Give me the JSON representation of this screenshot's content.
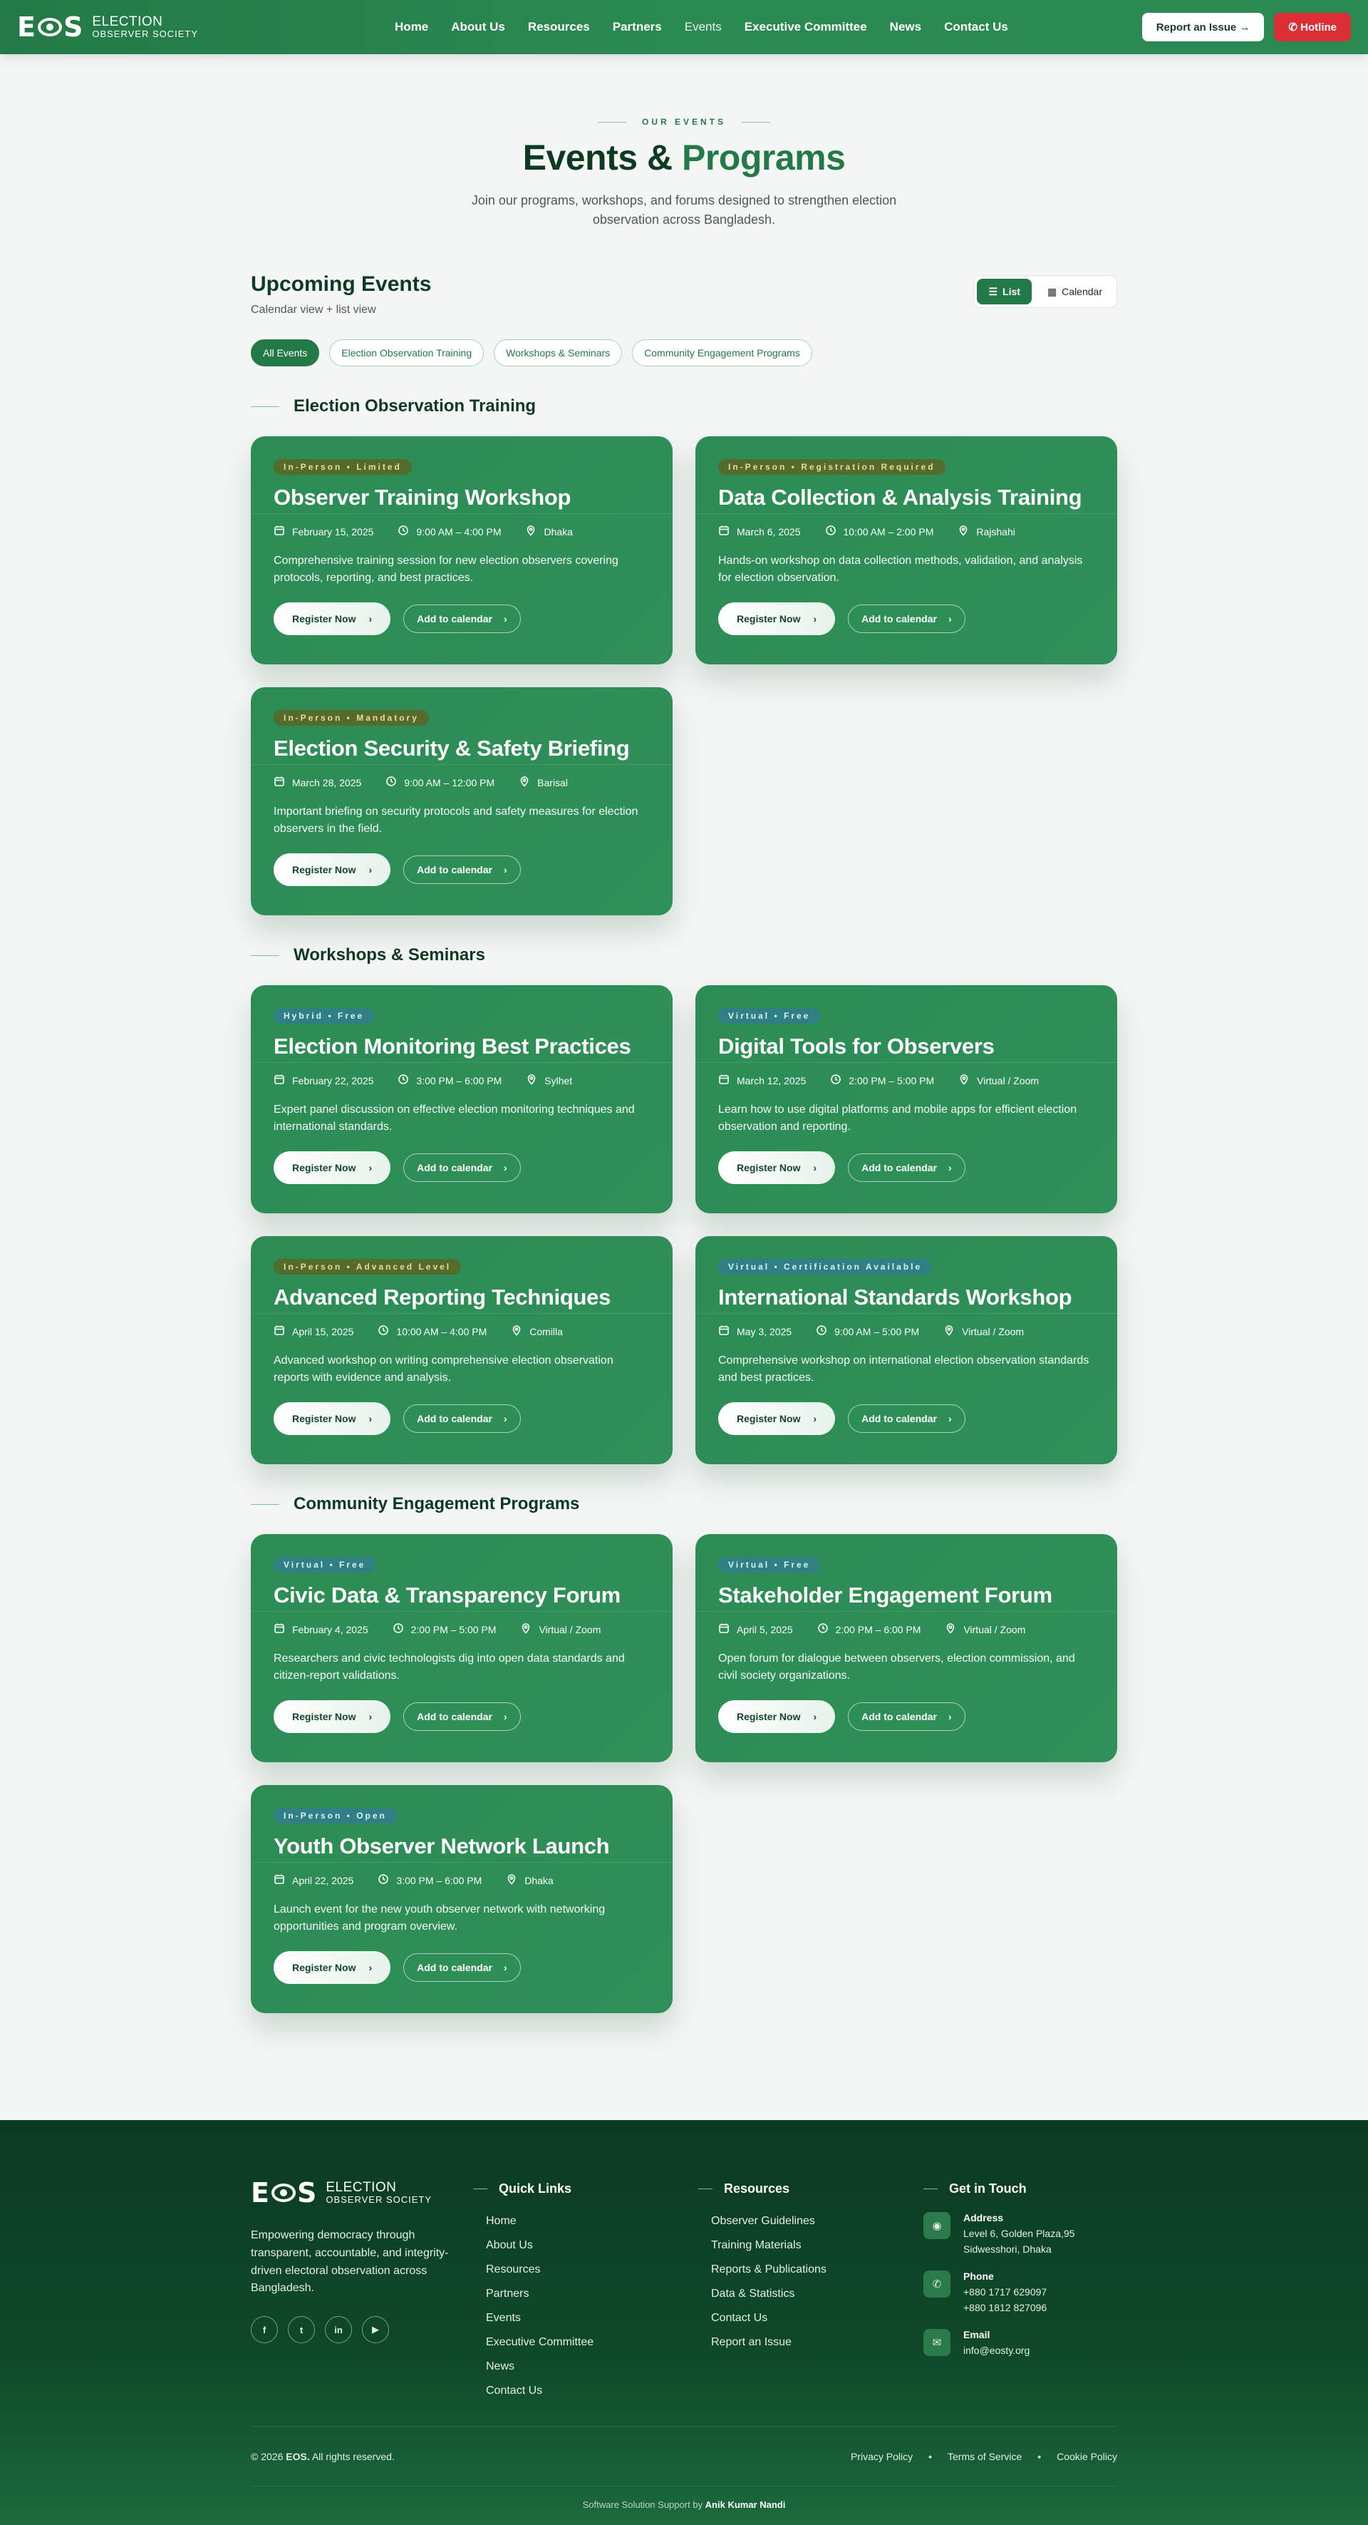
{
  "nav": {
    "logo_mark": "EOS",
    "logo_line1": "ELECTION",
    "logo_line2": "OBSERVER SOCIETY",
    "links": [
      "Home",
      "About Us",
      "Resources",
      "Partners",
      "Events",
      "Executive Committee",
      "News",
      "Contact Us"
    ],
    "active": "Events",
    "report_label": "Report an Issue",
    "hotline_label": "Hotline"
  },
  "hero": {
    "eyebrow": "OUR EVENTS",
    "title_part1": "Events &",
    "title_part2": "Programs",
    "subtitle": "Join our programs, workshops, and forums designed to strengthen election observation across Bangladesh."
  },
  "upcoming": {
    "title": "Upcoming Events",
    "subtitle": "Calendar view + list view",
    "view_list": "List",
    "view_calendar": "Calendar",
    "filters": [
      "All Events",
      "Election Observation Training",
      "Workshops & Seminars",
      "Community Engagement Programs"
    ]
  },
  "card_labels": {
    "register": "Register Now",
    "calendar": "Add to calendar"
  },
  "sections": [
    {
      "title": "Election Observation Training",
      "events": [
        {
          "badge": "In-Person • Limited",
          "tone": "gold",
          "title": "Observer Training Workshop",
          "date": "February 15, 2025",
          "time": "9:00 AM – 4:00 PM",
          "location": "Dhaka",
          "desc": "Comprehensive training session for new election observers covering protocols, reporting, and best practices."
        },
        {
          "badge": "In-Person • Registration Required",
          "tone": "gold",
          "title": "Data Collection & Analysis Training",
          "date": "March 6, 2025",
          "time": "10:00 AM – 2:00 PM",
          "location": "Rajshahi",
          "desc": "Hands-on workshop on data collection methods, validation, and analysis for election observation."
        },
        {
          "badge": "In-Person • Mandatory",
          "tone": "gold",
          "title": "Election Security & Safety Briefing",
          "date": "March 28, 2025",
          "time": "9:00 AM – 12:00 PM",
          "location": "Barisal",
          "desc": "Important briefing on security protocols and safety measures for election observers in the field."
        }
      ]
    },
    {
      "title": "Workshops & Seminars",
      "events": [
        {
          "badge": "Hybrid • Free",
          "tone": "teal",
          "title": "Election Monitoring Best Practices",
          "date": "February 22, 2025",
          "time": "3:00 PM – 6:00 PM",
          "location": "Sylhet",
          "desc": "Expert panel discussion on effective election monitoring techniques and international standards."
        },
        {
          "badge": "Virtual • Free",
          "tone": "teal",
          "title": "Digital Tools for Observers",
          "date": "March 12, 2025",
          "time": "2:00 PM – 5:00 PM",
          "location": "Virtual / Zoom",
          "desc": "Learn how to use digital platforms and mobile apps for efficient election observation and reporting."
        },
        {
          "badge": "In-Person • Advanced Level",
          "tone": "gold",
          "title": "Advanced Reporting Techniques",
          "date": "April 15, 2025",
          "time": "10:00 AM – 4:00 PM",
          "location": "Comilla",
          "desc": "Advanced workshop on writing comprehensive election observation reports with evidence and analysis."
        },
        {
          "badge": "Virtual • Certification Available",
          "tone": "teal",
          "title": "International Standards Workshop",
          "date": "May 3, 2025",
          "time": "9:00 AM – 5:00 PM",
          "location": "Virtual / Zoom",
          "desc": "Comprehensive workshop on international election observation standards and best practices."
        }
      ]
    },
    {
      "title": "Community Engagement Programs",
      "events": [
        {
          "badge": "Virtual • Free",
          "tone": "teal",
          "title": "Civic Data & Transparency Forum",
          "date": "February 4, 2025",
          "time": "2:00 PM – 5:00 PM",
          "location": "Virtual / Zoom",
          "desc": "Researchers and civic technologists dig into open data standards and citizen-report validations."
        },
        {
          "badge": "Virtual • Free",
          "tone": "teal",
          "title": "Stakeholder Engagement Forum",
          "date": "April 5, 2025",
          "time": "2:00 PM – 6:00 PM",
          "location": "Virtual / Zoom",
          "desc": "Open forum for dialogue between observers, election commission, and civil society organizations."
        },
        {
          "badge": "In-Person • Open",
          "tone": "teal",
          "title": "Youth Observer Network Launch",
          "date": "April 22, 2025",
          "time": "3:00 PM – 6:00 PM",
          "location": "Dhaka",
          "desc": "Launch event for the new youth observer network with networking opportunities and program overview."
        }
      ]
    }
  ],
  "footer": {
    "about": "Empowering democracy through transparent, accountable, and integrity-driven electoral observation across Bangladesh.",
    "socials": [
      "f",
      "t",
      "in",
      "▶"
    ],
    "quick_links_title": "Quick Links",
    "quick_links": [
      "Home",
      "About Us",
      "Resources",
      "Partners",
      "Events",
      "Executive Committee",
      "News",
      "Contact Us"
    ],
    "resources_title": "Resources",
    "resources": [
      "Observer Guidelines",
      "Training Materials",
      "Reports & Publications",
      "Data & Statistics",
      "Contact Us",
      "Report an Issue"
    ],
    "contact_title": "Get in Touch",
    "address_label": "Address",
    "address": "Level 6, Golden Plaza,95 Sidwesshori, Dhaka",
    "phone_label": "Phone",
    "phone1": "+880 1717 629097",
    "phone2": "+880 1812 827096",
    "email_label": "Email",
    "email": "info@eosty.org",
    "copyright_prefix": "© 2026",
    "copyright_brand": "EOS.",
    "copyright_suffix": "All rights reserved.",
    "legal": [
      "Privacy Policy",
      "Terms of Service",
      "Cookie Policy"
    ],
    "credit_prefix": "Software Solution Support by",
    "credit_name": "Anik Kumar Nandi"
  },
  "colors": {
    "primary": "#237a46",
    "card": "#2b8c54",
    "hotline": "#dc2f35",
    "footer": "#0b3a22"
  }
}
